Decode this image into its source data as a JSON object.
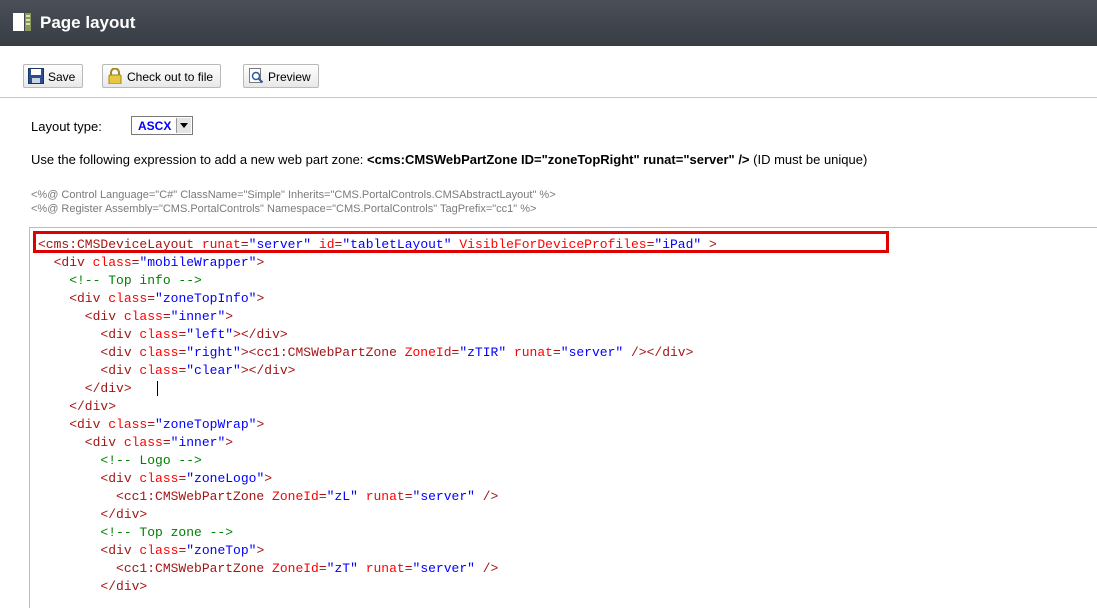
{
  "header": {
    "title": "Page layout",
    "icon": "layout-icon"
  },
  "toolbar": {
    "save": "Save",
    "checkout": "Check out to file",
    "preview": "Preview"
  },
  "layout_type": {
    "label": "Layout type:",
    "value": "ASCX"
  },
  "info": {
    "prefix": "Use the following expression to add a new web part zone: ",
    "expression": "<cms:CMSWebPartZone ID=\"zoneTopRight\" runat=\"server\" />",
    "suffix": " (ID must be unique)"
  },
  "directives": [
    "<%@ Control Language=\"C#\" ClassName=\"Simple\" Inherits=\"CMS.PortalControls.CMSAbstractLayout\" %>",
    "<%@ Register Assembly=\"CMS.PortalControls\" Namespace=\"CMS.PortalControls\" TagPrefix=\"cc1\" %>"
  ],
  "code": [
    [
      [
        "tag",
        "<cms:CMSDeviceLayout "
      ],
      [
        "attr",
        "runat"
      ],
      [
        "tag",
        "="
      ],
      [
        "val",
        "\"server\""
      ],
      [
        "tag",
        " "
      ],
      [
        "attr",
        "id"
      ],
      [
        "tag",
        "="
      ],
      [
        "val",
        "\"tabletLayout\""
      ],
      [
        "tag",
        " "
      ],
      [
        "attr",
        "VisibleForDeviceProfiles"
      ],
      [
        "tag",
        "="
      ],
      [
        "val",
        "\"iPad\""
      ],
      [
        "tag",
        " >"
      ]
    ],
    [
      [
        "tag",
        "  <div "
      ],
      [
        "attr",
        "class"
      ],
      [
        "tag",
        "="
      ],
      [
        "val",
        "\"mobileWrapper\""
      ],
      [
        "tag",
        ">"
      ]
    ],
    [
      [
        "cmt",
        "    <!-- Top info -->"
      ]
    ],
    [
      [
        "tag",
        "    <div "
      ],
      [
        "attr",
        "class"
      ],
      [
        "tag",
        "="
      ],
      [
        "val",
        "\"zoneTopInfo\""
      ],
      [
        "tag",
        ">"
      ]
    ],
    [
      [
        "tag",
        "      <div "
      ],
      [
        "attr",
        "class"
      ],
      [
        "tag",
        "="
      ],
      [
        "val",
        "\"inner\""
      ],
      [
        "tag",
        ">"
      ]
    ],
    [
      [
        "tag",
        "        <div "
      ],
      [
        "attr",
        "class"
      ],
      [
        "tag",
        "="
      ],
      [
        "val",
        "\"left\""
      ],
      [
        "tag",
        "></div>"
      ]
    ],
    [
      [
        "tag",
        "        <div "
      ],
      [
        "attr",
        "class"
      ],
      [
        "tag",
        "="
      ],
      [
        "val",
        "\"right\""
      ],
      [
        "tag",
        "><cc1:CMSWebPartZone "
      ],
      [
        "attr",
        "ZoneId"
      ],
      [
        "tag",
        "="
      ],
      [
        "val",
        "\"zTIR\""
      ],
      [
        "tag",
        " "
      ],
      [
        "attr",
        "runat"
      ],
      [
        "tag",
        "="
      ],
      [
        "val",
        "\"server\""
      ],
      [
        "tag",
        " /></div>"
      ]
    ],
    [
      [
        "tag",
        "        <div "
      ],
      [
        "attr",
        "class"
      ],
      [
        "tag",
        "="
      ],
      [
        "val",
        "\"clear\""
      ],
      [
        "tag",
        "></div>"
      ]
    ],
    [
      [
        "tag",
        "      </div>"
      ]
    ],
    [
      [
        "tag",
        "    </div>"
      ]
    ],
    [
      [
        "tag",
        "    <div "
      ],
      [
        "attr",
        "class"
      ],
      [
        "tag",
        "="
      ],
      [
        "val",
        "\"zoneTopWrap\""
      ],
      [
        "tag",
        ">"
      ]
    ],
    [
      [
        "tag",
        "      <div "
      ],
      [
        "attr",
        "class"
      ],
      [
        "tag",
        "="
      ],
      [
        "val",
        "\"inner\""
      ],
      [
        "tag",
        ">"
      ]
    ],
    [
      [
        "cmt",
        "        <!-- Logo -->"
      ]
    ],
    [
      [
        "tag",
        "        <div "
      ],
      [
        "attr",
        "class"
      ],
      [
        "tag",
        "="
      ],
      [
        "val",
        "\"zoneLogo\""
      ],
      [
        "tag",
        ">"
      ]
    ],
    [
      [
        "tag",
        "          <cc1:CMSWebPartZone "
      ],
      [
        "attr",
        "ZoneId"
      ],
      [
        "tag",
        "="
      ],
      [
        "val",
        "\"zL\""
      ],
      [
        "tag",
        " "
      ],
      [
        "attr",
        "runat"
      ],
      [
        "tag",
        "="
      ],
      [
        "val",
        "\"server\""
      ],
      [
        "tag",
        " />"
      ]
    ],
    [
      [
        "tag",
        "        </div>"
      ]
    ],
    [
      [
        "cmt",
        "        <!-- Top zone -->"
      ]
    ],
    [
      [
        "tag",
        "        <div "
      ],
      [
        "attr",
        "class"
      ],
      [
        "tag",
        "="
      ],
      [
        "val",
        "\"zoneTop\""
      ],
      [
        "tag",
        ">"
      ]
    ],
    [
      [
        "tag",
        "          <cc1:CMSWebPartZone "
      ],
      [
        "attr",
        "ZoneId"
      ],
      [
        "tag",
        "="
      ],
      [
        "val",
        "\"zT\""
      ],
      [
        "tag",
        " "
      ],
      [
        "attr",
        "runat"
      ],
      [
        "tag",
        "="
      ],
      [
        "val",
        "\"server\""
      ],
      [
        "tag",
        " />"
      ]
    ],
    [
      [
        "tag",
        "        </div>"
      ]
    ]
  ]
}
